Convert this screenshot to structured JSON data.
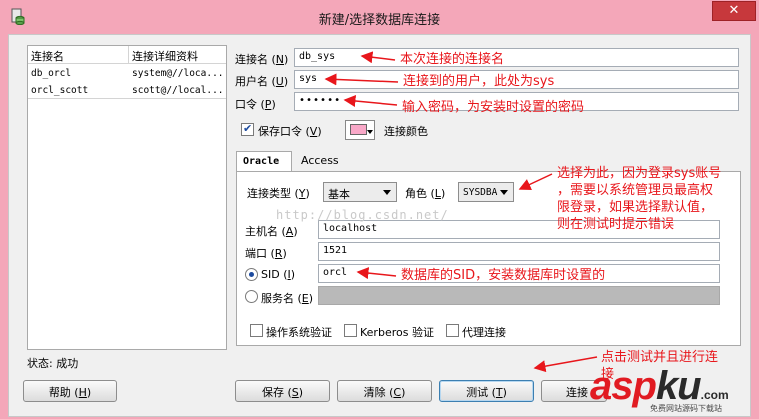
{
  "window": {
    "title": "新建/选择数据库连接",
    "close_label": "✕"
  },
  "list": {
    "columns": [
      "连接名",
      "连接详细资料"
    ],
    "rows": [
      {
        "name": "db_orcl",
        "detail": "system@//loca..."
      },
      {
        "name": "orcl_scott",
        "detail": "scott@//local..."
      }
    ]
  },
  "form": {
    "conn_name": {
      "label": "连接名",
      "mn": "N",
      "value": "db_sys"
    },
    "user_name": {
      "label": "用户名",
      "mn": "U",
      "value": "sys"
    },
    "password": {
      "label": "口令",
      "mn": "P",
      "value": "••••••"
    },
    "save_password": {
      "label": "保存口令",
      "mn": "V",
      "checked": true
    },
    "conn_color_label": "连接颜色",
    "conn_color": "#f9a8c8"
  },
  "tabs": [
    "Oracle",
    "Access"
  ],
  "oracle": {
    "conn_type": {
      "label": "连接类型",
      "mn": "Y",
      "value": "基本"
    },
    "role": {
      "label": "角色",
      "mn": "L",
      "value": "SYSDBA"
    },
    "host": {
      "label": "主机名",
      "mn": "A",
      "value": "localhost"
    },
    "port": {
      "label": "端口",
      "mn": "R",
      "value": "1521"
    },
    "sid": {
      "label": "SID",
      "mn": "I",
      "value": "orcl",
      "selected": true
    },
    "service": {
      "label": "服务名",
      "mn": "E",
      "value": "",
      "selected": false
    },
    "os_auth": "操作系统验证",
    "kerberos": "Kerberos 验证",
    "proxy": "代理连接"
  },
  "status": {
    "label": "状态:",
    "value": "成功"
  },
  "buttons": {
    "help": {
      "label": "帮助",
      "mn": "H"
    },
    "save": {
      "label": "保存",
      "mn": "S"
    },
    "clear": {
      "label": "清除",
      "mn": "C"
    },
    "test": {
      "label": "测试",
      "mn": "T"
    },
    "connect": {
      "label": "连接"
    }
  },
  "annotations": {
    "conn_name": "本次连接的连接名",
    "user": "连接到的用户，此处为sys",
    "password": "输入密码，为安装时设置的密码",
    "role": [
      "选择为此，因为登录sys账号",
      "，需要以系统管理员最高权",
      "限登录，如果选择默认值，",
      "则在测试时提示错误"
    ],
    "sid": "数据库的SID，安装数据库时设置的",
    "test": [
      "点击测试并且进行连",
      "接"
    ]
  },
  "watermark": "http://blog.csdn.net/",
  "brand": {
    "part1": "asp",
    "part2": "ku",
    "tld": ".com",
    "tagline": "免费网站源码下载站"
  },
  "colors": {
    "annotation": "#e8161b",
    "titlebar": "#f4a7b9",
    "close": "#c7383c"
  }
}
